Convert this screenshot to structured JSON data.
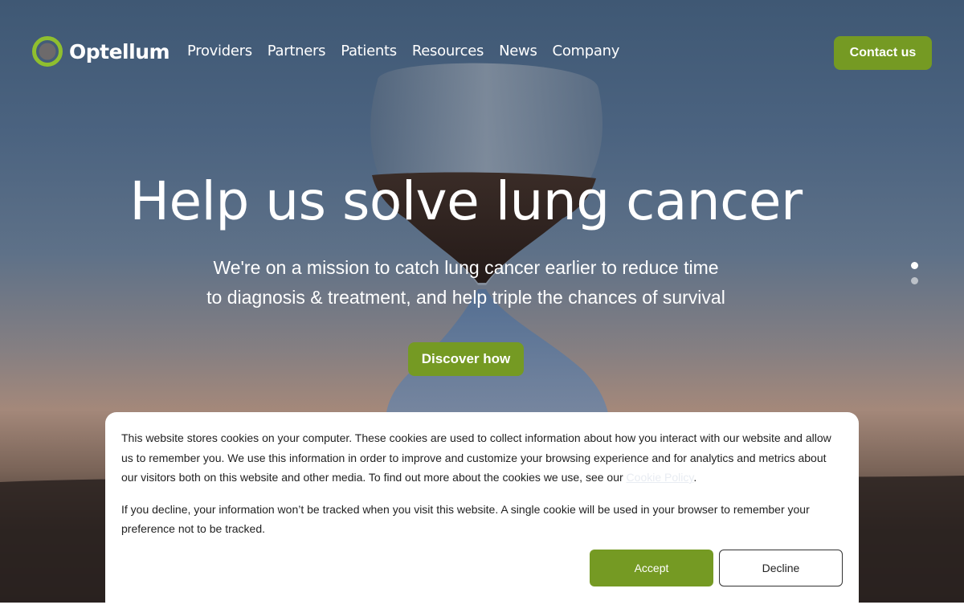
{
  "brand": {
    "name": "Optellum",
    "accent_color": "#759a23"
  },
  "nav": {
    "items": [
      {
        "label": "Providers"
      },
      {
        "label": "Partners"
      },
      {
        "label": "Patients"
      },
      {
        "label": "Resources"
      },
      {
        "label": "News"
      },
      {
        "label": "Company"
      }
    ],
    "contact_label": "Contact us"
  },
  "hero": {
    "title": "Help us solve lung cancer",
    "subtitle_line1": "We're on a mission to catch lung cancer earlier to reduce time",
    "subtitle_line2": "to diagnosis & treatment, and help triple the chances of survival",
    "cta_label": "Discover how",
    "background_image": "hourglass-at-sunset",
    "carousel": {
      "slides": 2,
      "active": 1
    }
  },
  "cookie_banner": {
    "text_before_link": "This website stores cookies on your computer. These cookies are used to collect information about how you interact with our website and allow us to remember you. We use this information in order to improve and customize your browsing experience and for analytics and metrics about our visitors both on this website and other media. To find out more about the cookies we use, see our ",
    "link_label": "Cookie Policy",
    "text_after_link": ".",
    "second_paragraph": "If you decline, your information won’t be tracked when you visit this website. A single cookie will be used in your browser to remember your preference not to be tracked.",
    "accept_label": "Accept",
    "decline_label": "Decline"
  }
}
